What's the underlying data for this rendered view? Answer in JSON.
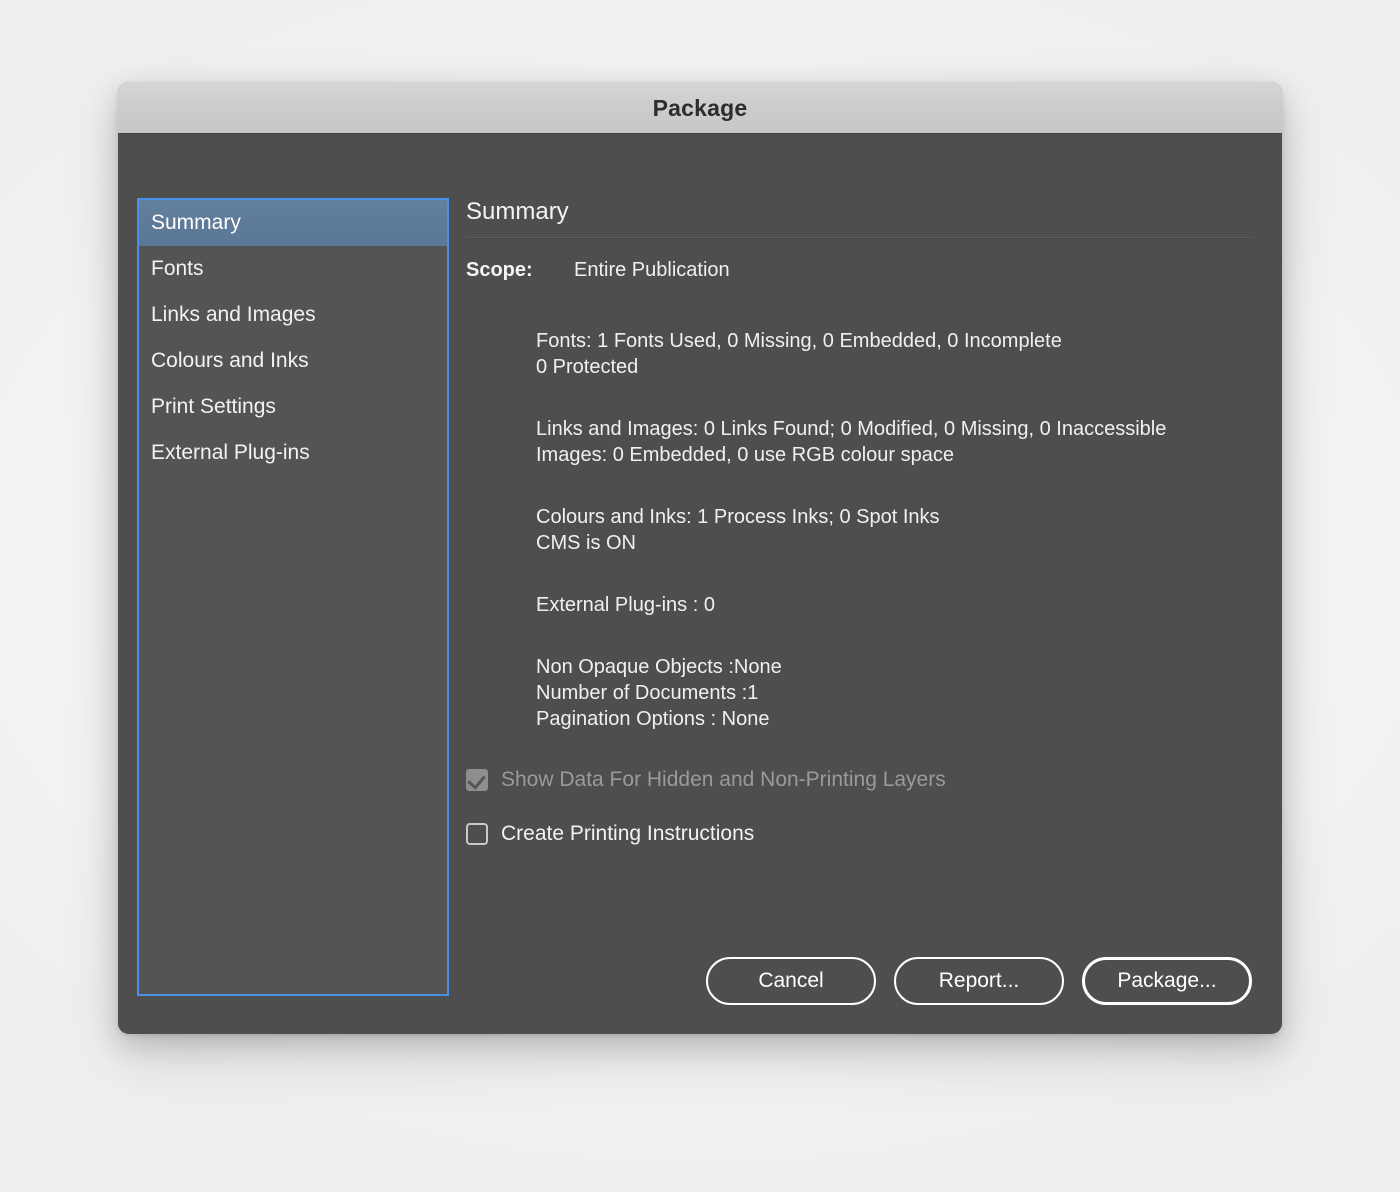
{
  "window": {
    "title": "Package"
  },
  "sidebar": {
    "items": [
      {
        "label": "Summary",
        "selected": true
      },
      {
        "label": "Fonts",
        "selected": false
      },
      {
        "label": "Links and Images",
        "selected": false
      },
      {
        "label": "Colours and Inks",
        "selected": false
      },
      {
        "label": "Print Settings",
        "selected": false
      },
      {
        "label": "External Plug-ins",
        "selected": false
      }
    ]
  },
  "content": {
    "heading": "Summary",
    "scope_label": "Scope:",
    "scope_value": "Entire Publication",
    "blocks": [
      {
        "name": "fonts-report",
        "lines": [
          "Fonts: 1 Fonts Used, 0 Missing, 0 Embedded, 0 Incomplete",
          "0 Protected"
        ]
      },
      {
        "name": "links-and-images-report",
        "lines": [
          "Links and Images: 0 Links Found; 0 Modified, 0 Missing, 0 Inaccessible",
          "Images: 0 Embedded, 0 use RGB colour space"
        ]
      },
      {
        "name": "colours-and-inks-report",
        "lines": [
          "Colours and Inks: 1 Process Inks; 0 Spot Inks",
          "CMS is ON"
        ]
      },
      {
        "name": "external-plug-ins-report",
        "lines": [
          "External Plug-ins : 0"
        ]
      },
      {
        "name": "document-report",
        "lines": [
          "Non Opaque Objects :None",
          "Number of Documents :1",
          "Pagination Options : None"
        ]
      }
    ],
    "checkboxes": [
      {
        "label": "Show Data For Hidden and Non-Printing Layers",
        "checked": true,
        "disabled": true
      },
      {
        "label": "Create Printing Instructions",
        "checked": false,
        "disabled": false
      }
    ]
  },
  "footer": {
    "cancel_label": "Cancel",
    "report_label": "Report...",
    "package_label": "Package..."
  },
  "colors": {
    "dialog_background": "#4e4e4e",
    "titlebar": "#cccccc",
    "selection_blue": "#5a7795",
    "focus_ring_blue": "#4a90e8",
    "text_primary": "#f0f0f0",
    "text_disabled": "#9a9a9a"
  }
}
